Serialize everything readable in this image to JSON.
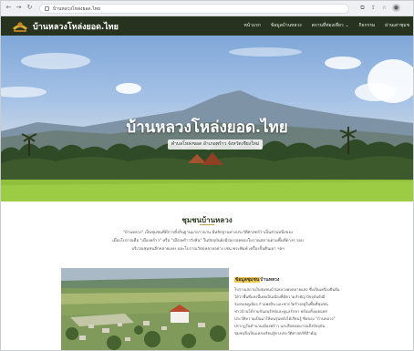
{
  "browser": {
    "url": "บ้านหลวงโหล่งยอด.ไทย",
    "icons": [
      "back-icon",
      "forward-icon",
      "reload-icon",
      "extension-icon",
      "share-icon",
      "star-icon",
      "profile-icon"
    ]
  },
  "header": {
    "site_title": "บ้านหลวงโหล่งยอด.ไทย",
    "menu": [
      "หน้าแรก",
      "ข้อมูลบ้านหลวง",
      "สถานที่ท่องเที่ยว ⌄",
      "กิจกรรม",
      "ผ่านเสาชุมช"
    ]
  },
  "hero": {
    "title": "บ้านหลวงโหล่งยอด.ไทย",
    "subtitle": "ตำบลโหล่งขอด อำเภอพร้าว จังหวัดเชียงใหม่"
  },
  "community": {
    "title": "ชุมชนบ้านหลวง",
    "lines": [
      "\"บ้านหลวง\" เป็นชุมชนที่มีการตั้งถิ่นฐานมายาวนาน มีหลักฐานทางประวัติศาสตร์ว่าเป็นส่วนหนึ่งของ",
      "เมืองโบราณคือ \"เมืองพร้าว\" หรือ \"เมืองพร้าววังหิน\" ในปัจจุบันยังมีร่องรอยของโบราณสถานตามพื้นที่ต่างๆ รอบ",
      "บริเวณชุมชนอีกหลายแห่ง และโบราณวัตถุหลายอย่าง เช่น พระพิมพ์ เครื่องปั้นดินเผา ฯลฯ"
    ]
  },
  "card": {
    "title_highlight": "ข้อมูลชุมชน",
    "title_rest": "บ้านหลวง",
    "lines": [
      "โบราณสถานในชุมชนบ้านหลวงพบหลายแห่ง ซึ่งเป็นเครื่องยืนยัน",
      "ได้ว่าพื้นที่แห่งนี้เคยเป็นเมืองที่มีความสำคัญ ปัจจุบันยังมี",
      "ร่องรอยคูเมือง กำแพงดิน และซากวัดร้างอยู่ในพื้นที่ชุมชน",
      "ชาวบ้านได้ร่วมกันอนุรักษ์และดูแลรักษา พร้อมทั้งเผยแพร่",
      "ประวัติความเป็นมาให้คนรุ่นหลังได้เรียนรู้ ชื่อของ \"บ้านหลวง\"",
      "ปรากฏในตำนานเมืองพร้าว และสืบทอดมาจนถึงปัจจุบัน",
      "ชุมชนจึงเป็นแหล่งเรียนรู้ทางประวัติศาสตร์ที่สำคัญ"
    ]
  },
  "colors": {
    "header_bg": "#27331f",
    "accent": "#c8a14a",
    "highlight": "#f2c84b"
  }
}
